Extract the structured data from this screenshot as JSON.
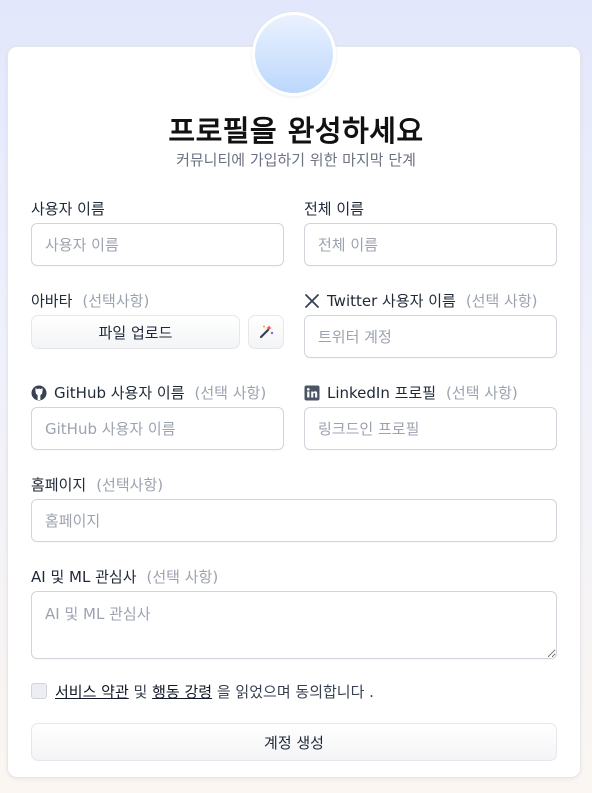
{
  "header": {
    "title": "프로필을 완성하세요",
    "subtitle": "커뮤니티에 가입하기 위한 마지막 단계"
  },
  "form": {
    "username": {
      "label": "사용자 이름",
      "placeholder": "사용자 이름",
      "value": ""
    },
    "fullname": {
      "label": "전체 이름",
      "placeholder": "전체 이름",
      "value": ""
    },
    "avatar": {
      "label": "아바타",
      "optional": "(선택사항)",
      "upload_label": "파일 업로드",
      "magic_icon": "magic-wand-icon"
    },
    "twitter": {
      "label": "Twitter 사용자 이름",
      "optional": "(선택 사항)",
      "placeholder": "트위터 계정",
      "icon": "x-logo-icon"
    },
    "github": {
      "label": "GitHub 사용자 이름",
      "optional": "(선택 사항)",
      "placeholder": "GitHub 사용자 이름",
      "icon": "github-icon"
    },
    "linkedin": {
      "label": "LinkedIn 프로필",
      "optional": "(선택 사항)",
      "placeholder": "링크드인 프로필",
      "icon": "linkedin-icon"
    },
    "homepage": {
      "label": "홈페이지",
      "optional": "(선택사항)",
      "placeholder": "홈페이지"
    },
    "interests": {
      "label": "AI 및 ML 관심사",
      "optional": "(선택 사항)",
      "placeholder": "AI 및 ML 관심사"
    },
    "agreement": {
      "checked": false,
      "terms_link": "서비스 약관",
      "and": " 및 ",
      "conduct_link": "행동 강령",
      "suffix": " 을 읽었으며 동의합니다 ."
    },
    "submit_label": "계정 생성"
  },
  "colors": {
    "accent_avatar": "#bcd7fb",
    "border": "#d1d5db",
    "muted": "#9ca3af"
  }
}
